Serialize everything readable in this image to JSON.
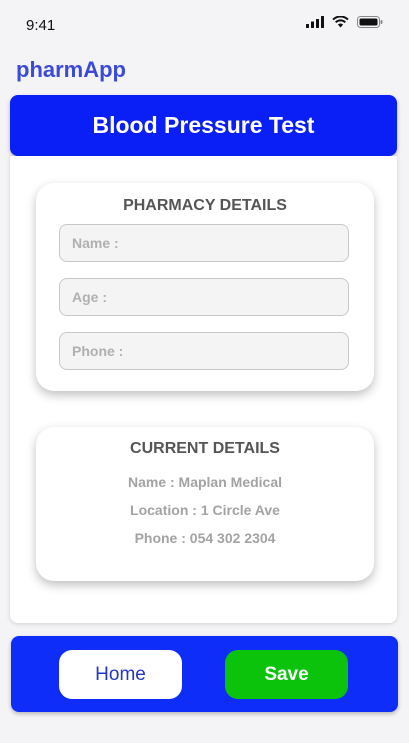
{
  "status_bar": {
    "time": "9:41"
  },
  "app": {
    "name": "pharmApp"
  },
  "header": {
    "title": "Blood Pressure Test"
  },
  "pharmacy_details": {
    "title": "PHARMACY DETAILS",
    "fields": [
      {
        "placeholder": "Name :",
        "value": ""
      },
      {
        "placeholder": "Age :",
        "value": ""
      },
      {
        "placeholder": "Phone :",
        "value": ""
      }
    ]
  },
  "current_details": {
    "title": "CURRENT DETAILS",
    "lines": [
      "Name : Maplan Medical",
      "Location : 1 Circle Ave",
      "Phone : 054 302 2304"
    ]
  },
  "footer": {
    "home_label": "Home",
    "save_label": "Save"
  },
  "colors": {
    "primary": "#0a1ff5",
    "save": "#0cc30c",
    "app_name": "#3b4bd8"
  },
  "icons": [
    "cellular-signal-icon",
    "wifi-icon",
    "battery-icon"
  ]
}
